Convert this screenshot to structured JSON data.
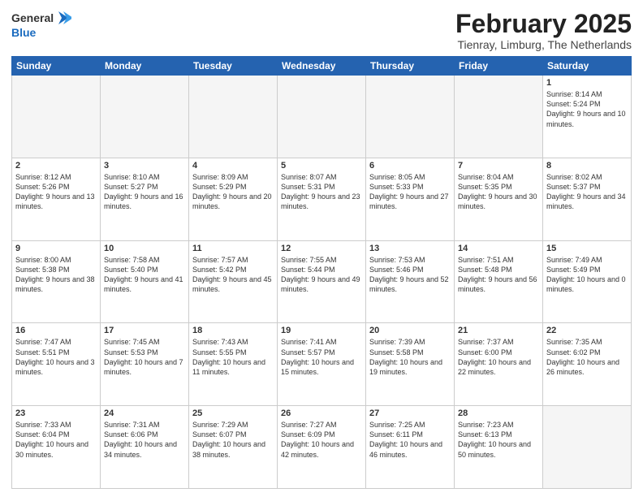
{
  "header": {
    "logo_general": "General",
    "logo_blue": "Blue",
    "title": "February 2025",
    "subtitle": "Tienray, Limburg, The Netherlands"
  },
  "weekdays": [
    "Sunday",
    "Monday",
    "Tuesday",
    "Wednesday",
    "Thursday",
    "Friday",
    "Saturday"
  ],
  "weeks": [
    [
      {
        "day": "",
        "info": ""
      },
      {
        "day": "",
        "info": ""
      },
      {
        "day": "",
        "info": ""
      },
      {
        "day": "",
        "info": ""
      },
      {
        "day": "",
        "info": ""
      },
      {
        "day": "",
        "info": ""
      },
      {
        "day": "1",
        "info": "Sunrise: 8:14 AM\nSunset: 5:24 PM\nDaylight: 9 hours and 10 minutes."
      }
    ],
    [
      {
        "day": "2",
        "info": "Sunrise: 8:12 AM\nSunset: 5:26 PM\nDaylight: 9 hours and 13 minutes."
      },
      {
        "day": "3",
        "info": "Sunrise: 8:10 AM\nSunset: 5:27 PM\nDaylight: 9 hours and 16 minutes."
      },
      {
        "day": "4",
        "info": "Sunrise: 8:09 AM\nSunset: 5:29 PM\nDaylight: 9 hours and 20 minutes."
      },
      {
        "day": "5",
        "info": "Sunrise: 8:07 AM\nSunset: 5:31 PM\nDaylight: 9 hours and 23 minutes."
      },
      {
        "day": "6",
        "info": "Sunrise: 8:05 AM\nSunset: 5:33 PM\nDaylight: 9 hours and 27 minutes."
      },
      {
        "day": "7",
        "info": "Sunrise: 8:04 AM\nSunset: 5:35 PM\nDaylight: 9 hours and 30 minutes."
      },
      {
        "day": "8",
        "info": "Sunrise: 8:02 AM\nSunset: 5:37 PM\nDaylight: 9 hours and 34 minutes."
      }
    ],
    [
      {
        "day": "9",
        "info": "Sunrise: 8:00 AM\nSunset: 5:38 PM\nDaylight: 9 hours and 38 minutes."
      },
      {
        "day": "10",
        "info": "Sunrise: 7:58 AM\nSunset: 5:40 PM\nDaylight: 9 hours and 41 minutes."
      },
      {
        "day": "11",
        "info": "Sunrise: 7:57 AM\nSunset: 5:42 PM\nDaylight: 9 hours and 45 minutes."
      },
      {
        "day": "12",
        "info": "Sunrise: 7:55 AM\nSunset: 5:44 PM\nDaylight: 9 hours and 49 minutes."
      },
      {
        "day": "13",
        "info": "Sunrise: 7:53 AM\nSunset: 5:46 PM\nDaylight: 9 hours and 52 minutes."
      },
      {
        "day": "14",
        "info": "Sunrise: 7:51 AM\nSunset: 5:48 PM\nDaylight: 9 hours and 56 minutes."
      },
      {
        "day": "15",
        "info": "Sunrise: 7:49 AM\nSunset: 5:49 PM\nDaylight: 10 hours and 0 minutes."
      }
    ],
    [
      {
        "day": "16",
        "info": "Sunrise: 7:47 AM\nSunset: 5:51 PM\nDaylight: 10 hours and 3 minutes."
      },
      {
        "day": "17",
        "info": "Sunrise: 7:45 AM\nSunset: 5:53 PM\nDaylight: 10 hours and 7 minutes."
      },
      {
        "day": "18",
        "info": "Sunrise: 7:43 AM\nSunset: 5:55 PM\nDaylight: 10 hours and 11 minutes."
      },
      {
        "day": "19",
        "info": "Sunrise: 7:41 AM\nSunset: 5:57 PM\nDaylight: 10 hours and 15 minutes."
      },
      {
        "day": "20",
        "info": "Sunrise: 7:39 AM\nSunset: 5:58 PM\nDaylight: 10 hours and 19 minutes."
      },
      {
        "day": "21",
        "info": "Sunrise: 7:37 AM\nSunset: 6:00 PM\nDaylight: 10 hours and 22 minutes."
      },
      {
        "day": "22",
        "info": "Sunrise: 7:35 AM\nSunset: 6:02 PM\nDaylight: 10 hours and 26 minutes."
      }
    ],
    [
      {
        "day": "23",
        "info": "Sunrise: 7:33 AM\nSunset: 6:04 PM\nDaylight: 10 hours and 30 minutes."
      },
      {
        "day": "24",
        "info": "Sunrise: 7:31 AM\nSunset: 6:06 PM\nDaylight: 10 hours and 34 minutes."
      },
      {
        "day": "25",
        "info": "Sunrise: 7:29 AM\nSunset: 6:07 PM\nDaylight: 10 hours and 38 minutes."
      },
      {
        "day": "26",
        "info": "Sunrise: 7:27 AM\nSunset: 6:09 PM\nDaylight: 10 hours and 42 minutes."
      },
      {
        "day": "27",
        "info": "Sunrise: 7:25 AM\nSunset: 6:11 PM\nDaylight: 10 hours and 46 minutes."
      },
      {
        "day": "28",
        "info": "Sunrise: 7:23 AM\nSunset: 6:13 PM\nDaylight: 10 hours and 50 minutes."
      },
      {
        "day": "",
        "info": ""
      }
    ]
  ]
}
